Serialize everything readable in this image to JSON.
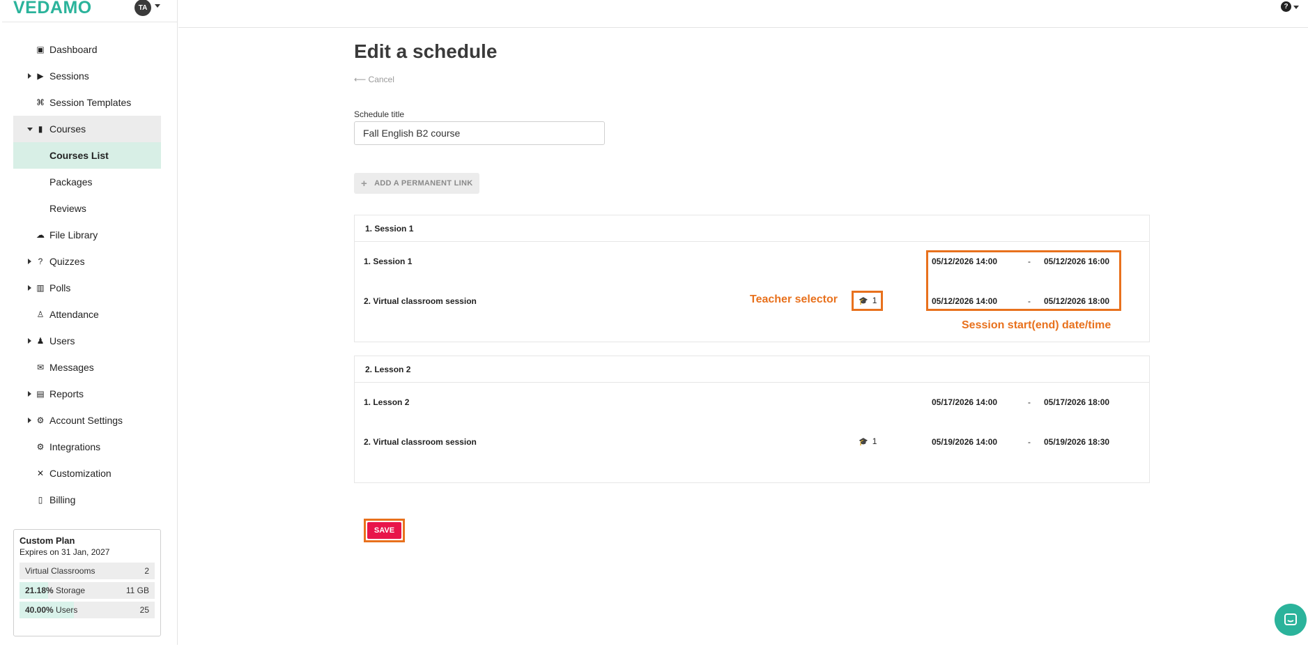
{
  "brand": {
    "logo": "VEDAMO",
    "avatar_initials": "TA"
  },
  "sidebar": {
    "items": [
      {
        "label": "Dashboard",
        "icon": "dashboard-icon",
        "caret": ""
      },
      {
        "label": "Sessions",
        "icon": "play-circle-icon",
        "caret": "right"
      },
      {
        "label": "Session Templates",
        "icon": "template-icon",
        "caret": ""
      },
      {
        "label": "Courses",
        "icon": "book-icon",
        "caret": "down",
        "state": "expanded"
      },
      {
        "label": "Courses List",
        "icon": "",
        "caret": "",
        "state": "selected"
      },
      {
        "label": "Packages",
        "icon": "",
        "caret": ""
      },
      {
        "label": "Reviews",
        "icon": "",
        "caret": ""
      },
      {
        "label": "File Library",
        "icon": "cloud-icon",
        "caret": ""
      },
      {
        "label": "Quizzes",
        "icon": "question-circle-icon",
        "caret": "right"
      },
      {
        "label": "Polls",
        "icon": "bar-chart-icon",
        "caret": "right"
      },
      {
        "label": "Attendance",
        "icon": "user-check-icon",
        "caret": ""
      },
      {
        "label": "Users",
        "icon": "users-icon",
        "caret": "right"
      },
      {
        "label": "Messages",
        "icon": "envelope-icon",
        "caret": ""
      },
      {
        "label": "Reports",
        "icon": "report-icon",
        "caret": "right"
      },
      {
        "label": "Account Settings",
        "icon": "gear-icon",
        "caret": "right"
      },
      {
        "label": "Integrations",
        "icon": "cogs-icon",
        "caret": ""
      },
      {
        "label": "Customization",
        "icon": "tools-icon",
        "caret": ""
      },
      {
        "label": "Billing",
        "icon": "invoice-icon",
        "caret": ""
      }
    ]
  },
  "plan": {
    "title": "Custom Plan",
    "expires": "Expires on 31 Jan, 2027",
    "rows": [
      {
        "percent": "",
        "label": "Virtual Classrooms",
        "value": "2",
        "fill": 0
      },
      {
        "percent": "21.18%",
        "label": "Storage",
        "value": "11 GB",
        "fill": 0.2118
      },
      {
        "percent": "40.00%",
        "label": "Users",
        "value": "25",
        "fill": 0.4
      }
    ]
  },
  "main": {
    "title": "Edit a schedule",
    "cancel_label": "Cancel",
    "schedule_title_label": "Schedule title",
    "schedule_title_value": "Fall English B2 course",
    "permanent_link_label": "ADD A PERMANENT LINK",
    "save_label": "SAVE"
  },
  "groups": [
    {
      "title": "1. Session 1",
      "sessions": [
        {
          "name": "1. Session 1",
          "teacher_count": "",
          "start": "05/12/2026 14:00",
          "end": "05/12/2026 16:00"
        },
        {
          "name": "2. Virtual classroom session",
          "teacher_count": "1",
          "start": "05/12/2026 14:00",
          "end": "05/12/2026 18:00"
        }
      ]
    },
    {
      "title": "2. Lesson 2",
      "sessions": [
        {
          "name": "1. Lesson 2",
          "teacher_count": "",
          "start": "05/17/2026 14:00",
          "end": "05/17/2026 18:00"
        },
        {
          "name": "2. Virtual classroom session",
          "teacher_count": "1",
          "start": "05/19/2026 14:00",
          "end": "05/19/2026 18:30"
        }
      ]
    }
  ],
  "date_separator": "-",
  "annotations": {
    "teacher_selector": "Teacher selector",
    "session_datetime": "Session start(end) date/time",
    "color": "#e8711d"
  },
  "colors": {
    "brand": "#2bb39b",
    "save": "#e8154a",
    "annotation": "#e8711d"
  }
}
